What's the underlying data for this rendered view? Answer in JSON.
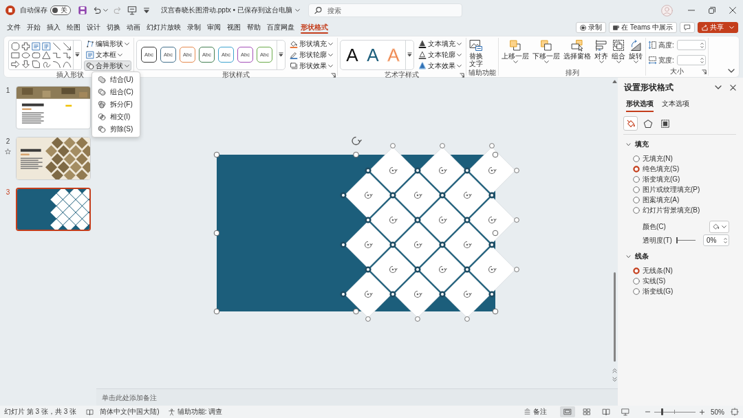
{
  "title_bar": {
    "autosave": {
      "label": "自动保存",
      "on": false,
      "state": "关"
    },
    "quick_access": [
      {
        "kind": "save",
        "disabled": false
      },
      {
        "kind": "undo",
        "disabled": false
      },
      {
        "kind": "redo",
        "disabled": true
      },
      {
        "kind": "present",
        "disabled": false
      },
      {
        "kind": "customize",
        "disabled": false
      }
    ],
    "document": "汉宫春晓长图滑动.pptx • 已保存到这台电脑",
    "search": {
      "placeholder": "搜索"
    }
  },
  "tabs": [
    {
      "label": "文件",
      "selected": false
    },
    {
      "label": "开始",
      "selected": false
    },
    {
      "label": "插入",
      "selected": false
    },
    {
      "label": "绘图",
      "selected": false
    },
    {
      "label": "设计",
      "selected": false
    },
    {
      "label": "切换",
      "selected": false
    },
    {
      "label": "动画",
      "selected": false
    },
    {
      "label": "幻灯片放映",
      "selected": false
    },
    {
      "label": "录制",
      "selected": false
    },
    {
      "label": "审阅",
      "selected": false
    },
    {
      "label": "视图",
      "selected": false
    },
    {
      "label": "帮助",
      "selected": false
    },
    {
      "label": "百度网盘",
      "selected": false
    },
    {
      "label": "形状格式",
      "selected": true
    }
  ],
  "tab_actions": [
    {
      "kind": "record",
      "label": "录制"
    },
    {
      "kind": "teams",
      "label": "在 Teams 中展示"
    },
    {
      "kind": "comments"
    },
    {
      "kind": "share",
      "label": "共享"
    }
  ],
  "ribbon": {
    "insert_shapes": {
      "label": "插入形状",
      "commands": [
        {
          "label": "编辑形状",
          "expanded": false
        },
        {
          "label": "文本框",
          "expanded": false
        },
        {
          "label": "合并形状",
          "expanded": true,
          "menu": [
            {
              "kind": "union",
              "label": "结合(U)"
            },
            {
              "kind": "combine",
              "label": "组合(C)"
            },
            {
              "kind": "fragment",
              "label": "拆分(F)"
            },
            {
              "kind": "intersect",
              "label": "相交(I)"
            },
            {
              "kind": "subtract",
              "label": "剪除(S)"
            }
          ]
        }
      ]
    },
    "shape_styles": {
      "label": "形状样式",
      "presets": [
        {
          "text": "Abc",
          "color": "#3a3a3a"
        },
        {
          "text": "Abc",
          "color": "#44718c"
        },
        {
          "text": "Abc",
          "color": "#e58a4e"
        },
        {
          "text": "Abc",
          "color": "#437f52"
        },
        {
          "text": "Abc",
          "color": "#3ea3cf"
        },
        {
          "text": "Abc",
          "color": "#a34fb8"
        },
        {
          "text": "Abc",
          "color": "#6aab4a"
        }
      ],
      "commands": [
        "形状填充",
        "形状轮廓",
        "形状效果"
      ]
    },
    "wordart_styles": {
      "label": "艺术字样式",
      "presets": [
        {
          "text": "A",
          "kind": "solid",
          "color": "#111111"
        },
        {
          "text": "A",
          "kind": "solid",
          "color": "#1d5f7c"
        },
        {
          "text": "A",
          "kind": "outline",
          "color": "#e97132"
        }
      ],
      "commands": [
        "文本填充",
        "文本轮廓",
        "文本效果"
      ]
    },
    "accessibility": {
      "label": "辅助功能",
      "command": "替换文字"
    },
    "arrange": {
      "label": "排列",
      "commands": [
        {
          "kind": "bring_forward",
          "label": "上移一层",
          "dropdown": true
        },
        {
          "kind": "send_backward",
          "label": "下移一层",
          "dropdown": true
        },
        {
          "kind": "selection_pane",
          "label": "选择窗格",
          "dropdown": false
        },
        {
          "kind": "align",
          "label": "对齐",
          "dropdown": true
        },
        {
          "kind": "group",
          "label": "组合",
          "dropdown": true
        },
        {
          "kind": "rotate",
          "label": "旋转",
          "dropdown": true
        }
      ]
    },
    "size": {
      "label": "大小",
      "fields": [
        {
          "kind": "height",
          "label": "高度:"
        },
        {
          "kind": "width",
          "label": "宽度:"
        }
      ]
    }
  },
  "slides": [
    {
      "number": "1",
      "kind": "title",
      "selected": false,
      "animated": false
    },
    {
      "number": "2",
      "kind": "gallery",
      "selected": false,
      "animated": true
    },
    {
      "number": "3",
      "kind": "pattern",
      "selected": true,
      "animated": false
    }
  ],
  "notes": {
    "placeholder": "单击此处添加备注"
  },
  "format_pane": {
    "title": "设置形状格式",
    "tabs": [
      {
        "label": "形状选项",
        "selected": true
      },
      {
        "label": "文本选项",
        "selected": false
      }
    ],
    "icon_tabs": [
      {
        "kind": "fill_line",
        "selected": true
      },
      {
        "kind": "effects",
        "selected": false
      },
      {
        "kind": "size_properties",
        "selected": false
      }
    ],
    "sections": [
      {
        "title": "填充",
        "expanded": true,
        "options": [
          {
            "label": "无填充(N)",
            "selected": false
          },
          {
            "label": "纯色填充(S)",
            "selected": true
          },
          {
            "label": "渐变填充(G)",
            "selected": false
          },
          {
            "label": "图片或纹理填充(P)",
            "selected": false
          },
          {
            "label": "图案填充(A)",
            "selected": false
          },
          {
            "label": "幻灯片背景填充(B)",
            "selected": false
          }
        ],
        "color": {
          "label": "颜色(C)"
        },
        "transparency": {
          "label": "透明度(T)",
          "level": 0,
          "value": "0%"
        }
      },
      {
        "title": "线条",
        "expanded": true,
        "options": [
          {
            "label": "无线条(N)",
            "selected": true
          },
          {
            "label": "实线(S)",
            "selected": false
          },
          {
            "label": "渐变线(G)",
            "selected": false
          }
        ]
      }
    ]
  },
  "status_bar": {
    "slide_info": "幻灯片 第 3 张，共 3 张",
    "language": "简体中文(中国大陆)",
    "accessibility": "辅助功能: 调查",
    "notes": "备注",
    "views": [
      {
        "kind": "normal",
        "selected": true
      },
      {
        "kind": "sorter",
        "selected": false
      },
      {
        "kind": "reading",
        "selected": false
      },
      {
        "kind": "slideshow",
        "selected": false
      }
    ],
    "zoom": {
      "level": 0.2,
      "value": "50%"
    }
  }
}
